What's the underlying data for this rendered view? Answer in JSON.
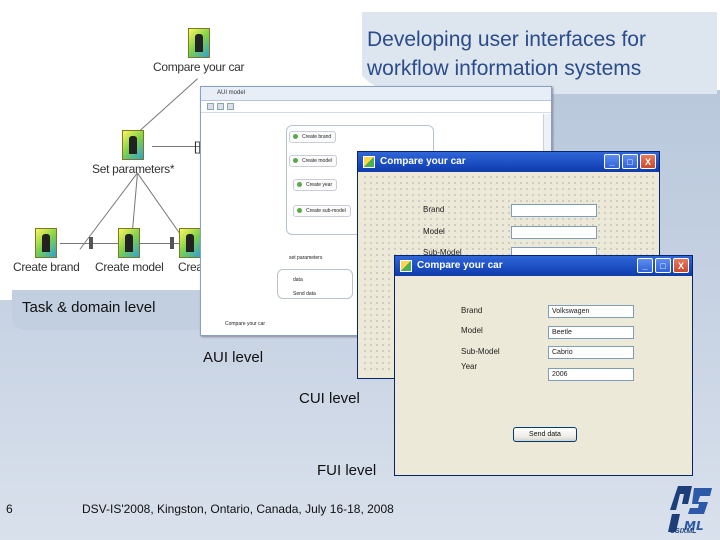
{
  "slide": {
    "title": "Developing user interfaces for workflow information systems",
    "slide_number": "6",
    "footer": "DSV-IS'2008, Kingston, Ontario, Canada, July 16-18, 2008",
    "colors": {
      "title": "#2b4c8a",
      "panel": "#c2cfe0",
      "accent": "#1c3f7a"
    }
  },
  "levels": {
    "task": "Task & domain level",
    "aui": "AUI level",
    "cui": "CUI level",
    "fui": "FUI level"
  },
  "task_tree": {
    "root": "Compare your car",
    "mid": "Set parameters*",
    "leaves": [
      "Create brand",
      "Create model",
      "Crea"
    ],
    "bracket": "[]"
  },
  "aui_window": {
    "title": "AUI model",
    "items": [
      "Create brand",
      "Create model",
      "Create year",
      "Create sub-model"
    ],
    "set_params": "set parameters",
    "data": "data",
    "send": "Send data",
    "bottom": "Compare your car",
    "icons": [
      "select-icon",
      "move-icon",
      "delete-icon"
    ]
  },
  "cui_window": {
    "title": "Compare your car",
    "labels": [
      "Brand",
      "Model",
      "Sub-Model"
    ]
  },
  "fui_window": {
    "title": "Compare your car",
    "labels": [
      "Brand",
      "Model",
      "Sub-Model",
      "Year"
    ],
    "values": [
      "Volkswagen",
      "Beetle",
      "Cabrio",
      "2006"
    ],
    "button": "Send data"
  },
  "window_buttons": {
    "minimize": "_",
    "maximize": "□",
    "close": "X"
  },
  "logo": {
    "text": "USIXML",
    "icon": "usixml-logo-icon"
  }
}
